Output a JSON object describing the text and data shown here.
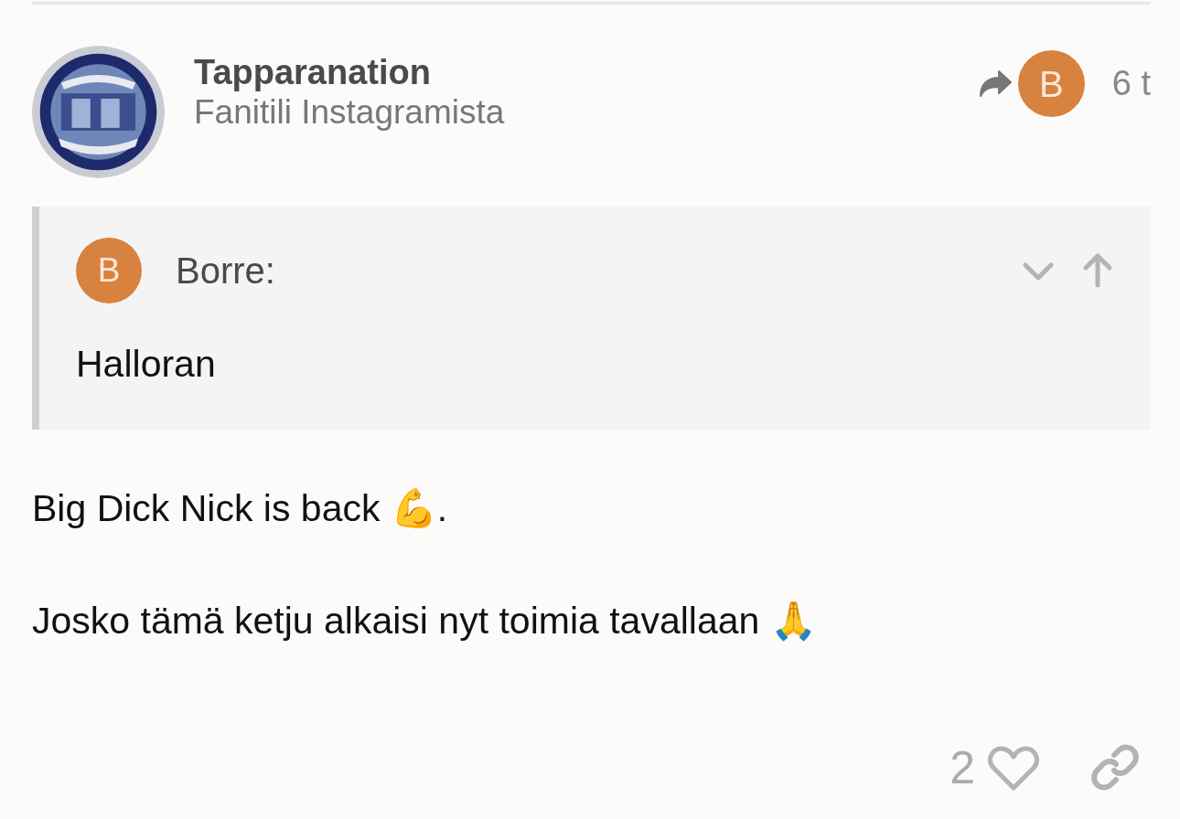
{
  "post": {
    "author": {
      "name": "Tapparanation",
      "title": "Fanitili Instagramista"
    },
    "reply_to": {
      "avatar_letter": "B",
      "color": "#d8823f"
    },
    "time": "6 t",
    "quote": {
      "avatar_letter": "B",
      "color": "#d8823f",
      "author": "Borre:",
      "expanded": false,
      "text": "Halloran"
    },
    "paragraphs": [
      "Big Dick Nick is back 💪.",
      "Josko tämä ketju alkaisi nyt toimia tavallaan 🙏"
    ],
    "likes": {
      "count": "2",
      "liked": false
    }
  }
}
